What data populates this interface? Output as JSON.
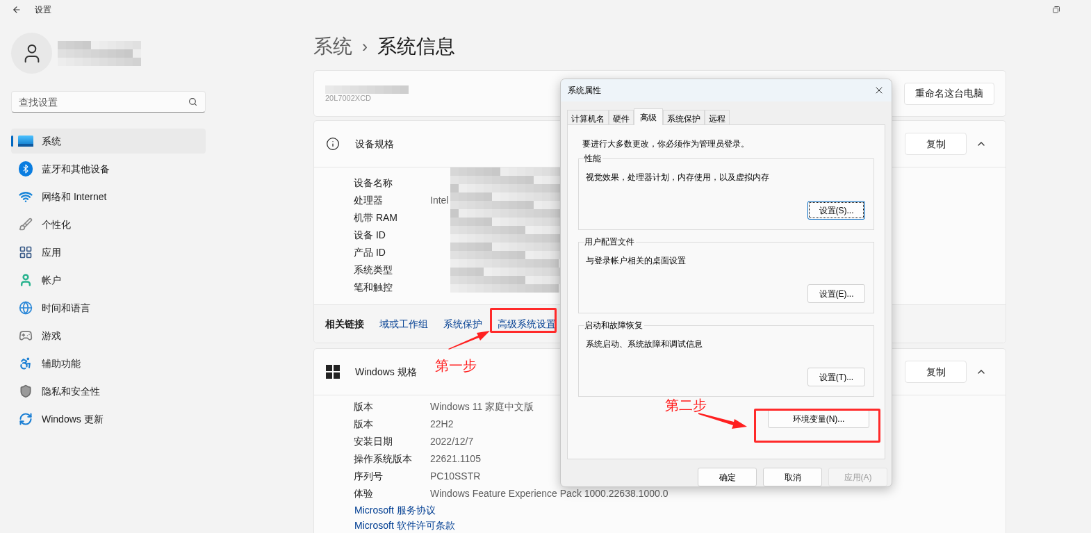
{
  "window": {
    "title": "设置"
  },
  "search": {
    "placeholder": "查找设置"
  },
  "sidebar": {
    "items": [
      {
        "label": "系统",
        "selected": true
      },
      {
        "label": "蓝牙和其他设备",
        "selected": false
      },
      {
        "label": "网络和 Internet",
        "selected": false
      },
      {
        "label": "个性化",
        "selected": false
      },
      {
        "label": "应用",
        "selected": false
      },
      {
        "label": "帐户",
        "selected": false
      },
      {
        "label": "时间和语言",
        "selected": false
      },
      {
        "label": "游戏",
        "selected": false
      },
      {
        "label": "辅助功能",
        "selected": false
      },
      {
        "label": "隐私和安全性",
        "selected": false
      },
      {
        "label": "Windows 更新",
        "selected": false
      }
    ]
  },
  "breadcrumb": {
    "parent": "系统",
    "separator": "›",
    "current": "系统信息"
  },
  "device_card": {
    "model": "20L7002XCD",
    "button": "重命名这台电脑"
  },
  "device_specs": {
    "title": "设备规格",
    "copy_button": "复制",
    "expanded": true,
    "rows": [
      {
        "label": "设备名称"
      },
      {
        "label": "处理器",
        "value": "Intel"
      },
      {
        "label": "机带 RAM"
      },
      {
        "label": "设备 ID"
      },
      {
        "label": "产品 ID"
      },
      {
        "label": "系统类型"
      },
      {
        "label": "笔和触控"
      }
    ],
    "related_label": "相关链接",
    "related_links": [
      "域或工作组",
      "系统保护",
      "高级系统设置"
    ]
  },
  "windows_specs": {
    "title": "Windows 规格",
    "copy_button": "复制",
    "expanded": true,
    "rows": [
      {
        "label": "版本",
        "value": "Windows 11 家庭中文版"
      },
      {
        "label": "版本",
        "value": "22H2"
      },
      {
        "label": "安装日期",
        "value": "2022/12/7"
      },
      {
        "label": "操作系统版本",
        "value": "22621.1105"
      },
      {
        "label": "序列号",
        "value": "PC10SSTR"
      },
      {
        "label": "体验",
        "value": "Windows Feature Experience Pack 1000.22638.1000.0"
      }
    ],
    "links": [
      "Microsoft 服务协议",
      "Microsoft 软件许可条款"
    ]
  },
  "dialog": {
    "title": "系统属性",
    "tabs": [
      {
        "label": "计算机名",
        "selected": false
      },
      {
        "label": "硬件",
        "selected": false
      },
      {
        "label": "高级",
        "selected": true
      },
      {
        "label": "系统保护",
        "selected": false
      },
      {
        "label": "远程",
        "selected": false
      }
    ],
    "admin_note": "要进行大多数更改，你必须作为管理员登录。",
    "groups": [
      {
        "title": "性能",
        "description": "视觉效果，处理器计划，内存使用，以及虚拟内存",
        "button": "设置(S)...",
        "focused": true
      },
      {
        "title": "用户配置文件",
        "description": "与登录帐户相关的桌面设置",
        "button": "设置(E)...",
        "focused": false
      },
      {
        "title": "启动和故障恢复",
        "description": "系统启动、系统故障和调试信息",
        "button": "设置(T)...",
        "focused": false
      }
    ],
    "env_button": "环境变量(N)...",
    "buttons": [
      {
        "label": "确定",
        "disabled": false
      },
      {
        "label": "取消",
        "disabled": false
      },
      {
        "label": "应用(A)",
        "disabled": true
      }
    ]
  },
  "annotations": [
    {
      "text": "第一步"
    },
    {
      "text": "第二步"
    }
  ]
}
